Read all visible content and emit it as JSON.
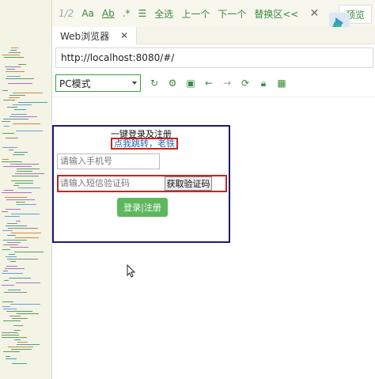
{
  "toolbar": {
    "counter": "1/2",
    "match_case": "Aa",
    "whole_word": "Ab",
    "regex": ".*",
    "select_all": "全选",
    "prev": "上一个",
    "next": "下一个",
    "replace": "替换区<<",
    "close": "✕",
    "preview": "预览"
  },
  "browser": {
    "tab_title": "Web浏览器",
    "tab_close": "✕",
    "url": "http://localhost:8080/#/",
    "mode": "PC模式"
  },
  "login": {
    "title": "一键登录及注册",
    "link": "点我跳转，老铁",
    "phone_placeholder": "请输入手机号",
    "sms_placeholder": "请输入短信验证码",
    "get_code": "获取验证码",
    "submit": "登录|注册"
  },
  "colors": {
    "accent": "#3a8b3a",
    "submit_bg": "#5cb85c",
    "highlight_border": "#cc2222",
    "frame_border": "#1a1a7a"
  }
}
